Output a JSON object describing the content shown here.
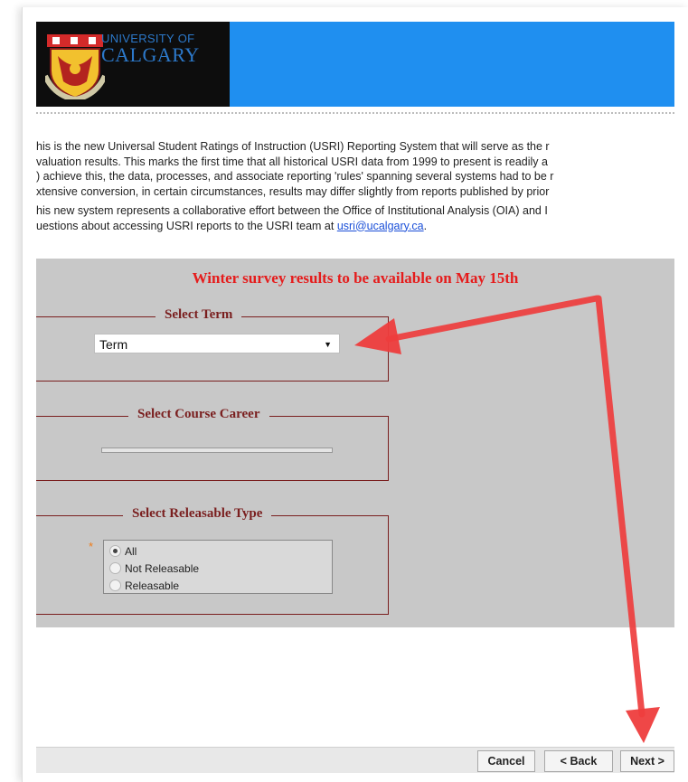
{
  "logo": {
    "university_line1": "UNIVERSITY OF",
    "university_line2": "CALGARY"
  },
  "intro": {
    "lines": [
      "his is the new Universal Student Ratings of Instruction (USRI) Reporting System that will serve as the r",
      "valuation results.  This marks the first time that all historical USRI data from 1999 to present is readily a",
      ") achieve this, the data, processes, and associate reporting 'rules' spanning several systems had to be r",
      "xtensive conversion, in certain circumstances, results may differ slightly from reports published by prior",
      "his new system represents a collaborative effort between the Office of Institutional Analysis (OIA) and I"
    ],
    "last_line_prefix": "uestions about accessing USRI reports to the USRI team at ",
    "email_link": "usri@ucalgary.ca",
    "last_line_suffix": "."
  },
  "form": {
    "notice": "Winter survey results to be available on May 15th",
    "term_legend": "Select Term",
    "term_selected": "Term",
    "career_legend": "Select Course Career",
    "releasable_legend": "Select Releasable Type",
    "required_marker": "*",
    "releasable_options": [
      "All",
      "Not Releasable",
      "Releasable"
    ],
    "releasable_selected_index": 0
  },
  "buttons": {
    "cancel": "Cancel",
    "back": "< Back",
    "next": "Next >"
  },
  "colors": {
    "banner_blue": "#1f8ff0",
    "notice_red": "#e51c1c",
    "legend_maroon": "#7a1f1f",
    "annotation_arrow": "#ee3d3d"
  }
}
